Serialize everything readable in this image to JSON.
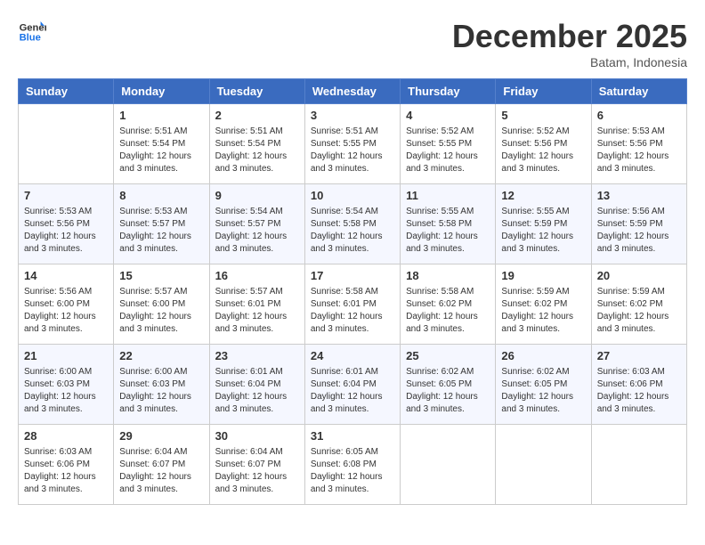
{
  "header": {
    "logo_text_general": "General",
    "logo_text_blue": "Blue",
    "month_title": "December 2025",
    "location": "Batam, Indonesia"
  },
  "days_of_week": [
    "Sunday",
    "Monday",
    "Tuesday",
    "Wednesday",
    "Thursday",
    "Friday",
    "Saturday"
  ],
  "weeks": [
    [
      {
        "day": "",
        "info": ""
      },
      {
        "day": "1",
        "info": "Sunrise: 5:51 AM\nSunset: 5:54 PM\nDaylight: 12 hours\nand 3 minutes."
      },
      {
        "day": "2",
        "info": "Sunrise: 5:51 AM\nSunset: 5:54 PM\nDaylight: 12 hours\nand 3 minutes."
      },
      {
        "day": "3",
        "info": "Sunrise: 5:51 AM\nSunset: 5:55 PM\nDaylight: 12 hours\nand 3 minutes."
      },
      {
        "day": "4",
        "info": "Sunrise: 5:52 AM\nSunset: 5:55 PM\nDaylight: 12 hours\nand 3 minutes."
      },
      {
        "day": "5",
        "info": "Sunrise: 5:52 AM\nSunset: 5:56 PM\nDaylight: 12 hours\nand 3 minutes."
      },
      {
        "day": "6",
        "info": "Sunrise: 5:53 AM\nSunset: 5:56 PM\nDaylight: 12 hours\nand 3 minutes."
      }
    ],
    [
      {
        "day": "7",
        "info": "Sunrise: 5:53 AM\nSunset: 5:56 PM\nDaylight: 12 hours\nand 3 minutes."
      },
      {
        "day": "8",
        "info": "Sunrise: 5:53 AM\nSunset: 5:57 PM\nDaylight: 12 hours\nand 3 minutes."
      },
      {
        "day": "9",
        "info": "Sunrise: 5:54 AM\nSunset: 5:57 PM\nDaylight: 12 hours\nand 3 minutes."
      },
      {
        "day": "10",
        "info": "Sunrise: 5:54 AM\nSunset: 5:58 PM\nDaylight: 12 hours\nand 3 minutes."
      },
      {
        "day": "11",
        "info": "Sunrise: 5:55 AM\nSunset: 5:58 PM\nDaylight: 12 hours\nand 3 minutes."
      },
      {
        "day": "12",
        "info": "Sunrise: 5:55 AM\nSunset: 5:59 PM\nDaylight: 12 hours\nand 3 minutes."
      },
      {
        "day": "13",
        "info": "Sunrise: 5:56 AM\nSunset: 5:59 PM\nDaylight: 12 hours\nand 3 minutes."
      }
    ],
    [
      {
        "day": "14",
        "info": "Sunrise: 5:56 AM\nSunset: 6:00 PM\nDaylight: 12 hours\nand 3 minutes."
      },
      {
        "day": "15",
        "info": "Sunrise: 5:57 AM\nSunset: 6:00 PM\nDaylight: 12 hours\nand 3 minutes."
      },
      {
        "day": "16",
        "info": "Sunrise: 5:57 AM\nSunset: 6:01 PM\nDaylight: 12 hours\nand 3 minutes."
      },
      {
        "day": "17",
        "info": "Sunrise: 5:58 AM\nSunset: 6:01 PM\nDaylight: 12 hours\nand 3 minutes."
      },
      {
        "day": "18",
        "info": "Sunrise: 5:58 AM\nSunset: 6:02 PM\nDaylight: 12 hours\nand 3 minutes."
      },
      {
        "day": "19",
        "info": "Sunrise: 5:59 AM\nSunset: 6:02 PM\nDaylight: 12 hours\nand 3 minutes."
      },
      {
        "day": "20",
        "info": "Sunrise: 5:59 AM\nSunset: 6:02 PM\nDaylight: 12 hours\nand 3 minutes."
      }
    ],
    [
      {
        "day": "21",
        "info": "Sunrise: 6:00 AM\nSunset: 6:03 PM\nDaylight: 12 hours\nand 3 minutes."
      },
      {
        "day": "22",
        "info": "Sunrise: 6:00 AM\nSunset: 6:03 PM\nDaylight: 12 hours\nand 3 minutes."
      },
      {
        "day": "23",
        "info": "Sunrise: 6:01 AM\nSunset: 6:04 PM\nDaylight: 12 hours\nand 3 minutes."
      },
      {
        "day": "24",
        "info": "Sunrise: 6:01 AM\nSunset: 6:04 PM\nDaylight: 12 hours\nand 3 minutes."
      },
      {
        "day": "25",
        "info": "Sunrise: 6:02 AM\nSunset: 6:05 PM\nDaylight: 12 hours\nand 3 minutes."
      },
      {
        "day": "26",
        "info": "Sunrise: 6:02 AM\nSunset: 6:05 PM\nDaylight: 12 hours\nand 3 minutes."
      },
      {
        "day": "27",
        "info": "Sunrise: 6:03 AM\nSunset: 6:06 PM\nDaylight: 12 hours\nand 3 minutes."
      }
    ],
    [
      {
        "day": "28",
        "info": "Sunrise: 6:03 AM\nSunset: 6:06 PM\nDaylight: 12 hours\nand 3 minutes."
      },
      {
        "day": "29",
        "info": "Sunrise: 6:04 AM\nSunset: 6:07 PM\nDaylight: 12 hours\nand 3 minutes."
      },
      {
        "day": "30",
        "info": "Sunrise: 6:04 AM\nSunset: 6:07 PM\nDaylight: 12 hours\nand 3 minutes."
      },
      {
        "day": "31",
        "info": "Sunrise: 6:05 AM\nSunset: 6:08 PM\nDaylight: 12 hours\nand 3 minutes."
      },
      {
        "day": "",
        "info": ""
      },
      {
        "day": "",
        "info": ""
      },
      {
        "day": "",
        "info": ""
      }
    ]
  ]
}
